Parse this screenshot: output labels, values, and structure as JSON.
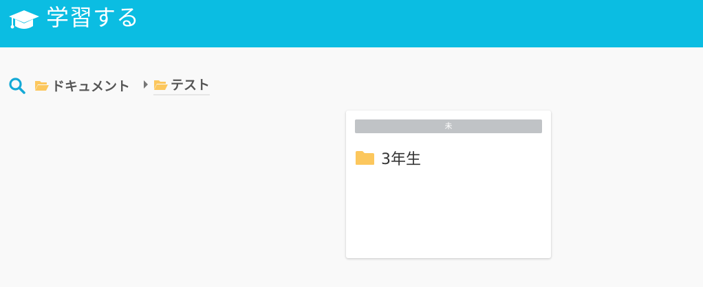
{
  "header": {
    "title": "学習する",
    "icon": "graduation-cap-icon",
    "bg_color": "#0bbde2"
  },
  "breadcrumb": {
    "search_icon": "search-icon",
    "items": [
      {
        "label": "ドキュメント",
        "icon": "folder-open-icon"
      },
      {
        "label": "テスト",
        "icon": "folder-open-icon"
      }
    ],
    "separator_icon": "caret-right-icon",
    "folder_color": "#fcc75d",
    "accent_color": "#14a9d6"
  },
  "card": {
    "badge": "未",
    "badge_color": "#c0c3c6",
    "item": {
      "label": "3年生",
      "icon": "folder-icon"
    }
  }
}
